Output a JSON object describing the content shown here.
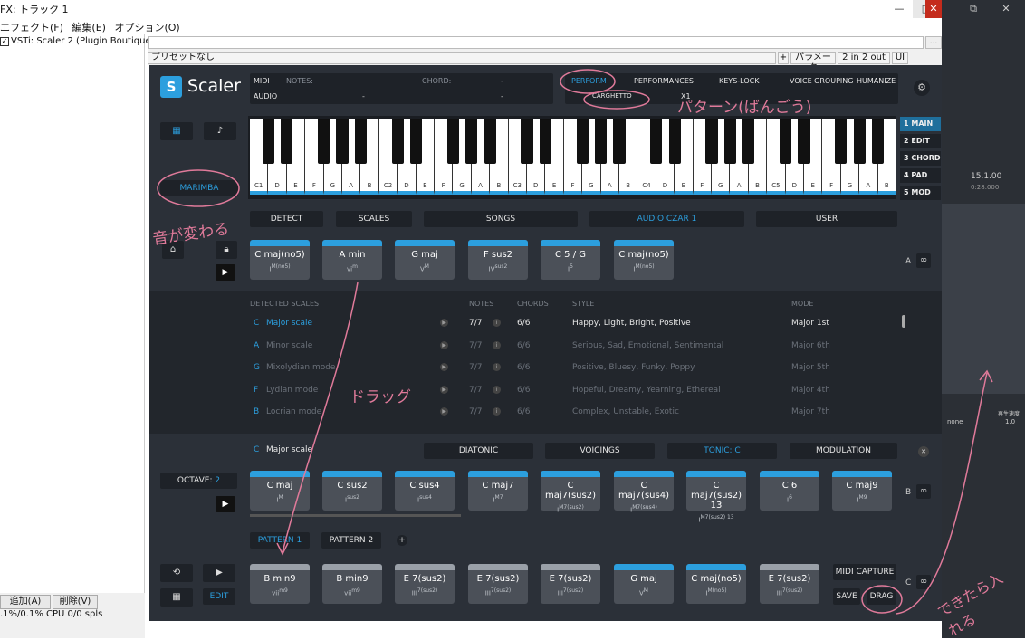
{
  "window": {
    "title": "FX: トラック 1",
    "minimize": "—",
    "restore": "□",
    "close": "✕",
    "right_restore": "⧉",
    "right_close": "✕"
  },
  "menu": [
    "エフェクト(F)",
    "編集(E)",
    "オプション(O)"
  ],
  "fx_list": {
    "item": "VSTi: Scaler 2 (Plugin Boutique)"
  },
  "bottom": {
    "add": "追加(A)",
    "remove": "削除(V)",
    "cpu": ".1%/0.1% CPU 0/0 spls"
  },
  "preset_bar": {
    "preset": "プリセットなし",
    "plus": "+",
    "params": "パラメータ",
    "io": "2 in 2 out",
    "ui": "UI",
    "more": "..."
  },
  "scaler": {
    "logo": "Scaler",
    "midi": "MIDI",
    "audio": "AUDIO",
    "notes_label": "NOTES:",
    "chord_label": "CHORD:",
    "dash": "-",
    "perform": "PERFORM",
    "performances": "PERFORMANCES",
    "carghetto": "CARGHETTO",
    "x1": "X1",
    "keys_lock": "KEYS-LOCK",
    "voice_grouping": "VOICE GROUPING",
    "humanize": "HUMANIZE",
    "sound": "MARIMBA",
    "side_tabs": [
      "1 MAIN",
      "2 EDIT",
      "3 CHORD",
      "4 PAD",
      "5 MOD"
    ],
    "octaves": [
      "C1",
      "C2",
      "C3",
      "C4",
      "C5"
    ],
    "white_keys": [
      "C1",
      "D",
      "E",
      "F",
      "G",
      "A",
      "B",
      "C2",
      "D",
      "E",
      "F",
      "G",
      "A",
      "B",
      "C3",
      "D",
      "E",
      "F",
      "G",
      "A",
      "B",
      "C4",
      "D",
      "E",
      "F",
      "G",
      "A",
      "B",
      "C5",
      "D",
      "E",
      "F",
      "G",
      "A",
      "B"
    ],
    "detect_bar": {
      "detect": "DETECT",
      "scales": "SCALES",
      "songs": "SONGS",
      "song": "AUDIO CZAR 1",
      "user": "USER"
    },
    "detected_chords": [
      {
        "name": "C maj(no5)",
        "roman": "I",
        "sup": "M(no5)"
      },
      {
        "name": "A min",
        "roman": "vi",
        "sup": "m"
      },
      {
        "name": "G maj",
        "roman": "V",
        "sup": "M"
      },
      {
        "name": "F sus2",
        "roman": "IV",
        "sup": "sus2"
      },
      {
        "name": "C 5 / G",
        "roman": "I",
        "sup": "5"
      },
      {
        "name": "C maj(no5)",
        "roman": "I",
        "sup": "M(no5)"
      }
    ],
    "section_a": "A",
    "scale_headers": {
      "scales": "DETECTED SCALES",
      "notes": "NOTES",
      "chords": "CHORDS",
      "style": "STYLE",
      "mode": "MODE"
    },
    "scales": [
      {
        "key": "C",
        "name": "Major scale",
        "notes": "7/7",
        "chords": "6/6",
        "style": "Happy, Light, Bright, Positive",
        "mode": "Major 1st"
      },
      {
        "key": "A",
        "name": "Minor scale",
        "notes": "7/7",
        "chords": "6/6",
        "style": "Serious, Sad, Emotional, Sentimental",
        "mode": "Major 6th"
      },
      {
        "key": "G",
        "name": "Mixolydian mode",
        "notes": "7/7",
        "chords": "6/6",
        "style": "Positive, Bluesy, Funky, Poppy",
        "mode": "Major 5th"
      },
      {
        "key": "F",
        "name": "Lydian mode",
        "notes": "7/7",
        "chords": "6/6",
        "style": "Hopeful, Dreamy, Yearning, Ethereal",
        "mode": "Major 4th"
      },
      {
        "key": "B",
        "name": "Locrian mode",
        "notes": "7/7",
        "chords": "6/6",
        "style": "Complex, Unstable, Exotic",
        "mode": "Major 7th"
      }
    ],
    "b_row": {
      "scale_key": "C",
      "scale_name": "Major scale",
      "diatonic": "DIATONIC",
      "voicings": "VOICINGS",
      "tonic": "TONIC: C",
      "modulation": "MODULATION"
    },
    "octave_label": "OCTAVE:",
    "octave_value": "2",
    "b_chords": [
      {
        "name": "C maj",
        "roman": "I",
        "sup": "M"
      },
      {
        "name": "C sus2",
        "roman": "I",
        "sup": "sus2"
      },
      {
        "name": "C sus4",
        "roman": "I",
        "sup": "sus4"
      },
      {
        "name": "C maj7",
        "roman": "I",
        "sup": "M7"
      },
      {
        "name": "C maj7(sus2)",
        "roman": "I",
        "sup": "M7(sus2)"
      },
      {
        "name": "C maj7(sus4)",
        "roman": "I",
        "sup": "M7(sus4)"
      },
      {
        "name": "C maj7(sus2) 13",
        "roman": "I",
        "sup": "M7(sus2) 13"
      },
      {
        "name": "C 6",
        "roman": "I",
        "sup": "6"
      },
      {
        "name": "C maj9",
        "roman": "I",
        "sup": "M9"
      }
    ],
    "section_b": "B",
    "pattern1": "PATTERN 1",
    "pattern2": "PATTERN 2",
    "c_chords": [
      {
        "name": "B min9",
        "roman": "vii",
        "sup": "m9"
      },
      {
        "name": "B min9",
        "roman": "vii",
        "sup": "m9"
      },
      {
        "name": "E 7(sus2)",
        "roman": "III",
        "sup": "7(sus2)"
      },
      {
        "name": "E 7(sus2)",
        "roman": "III",
        "sup": "7(sus2)"
      },
      {
        "name": "E 7(sus2)",
        "roman": "III",
        "sup": "7(sus2)"
      },
      {
        "name": "G maj",
        "roman": "V",
        "sup": "M"
      },
      {
        "name": "C maj(no5)",
        "roman": "I",
        "sup": "M(no5)"
      },
      {
        "name": "E 7(sus2)",
        "roman": "III",
        "sup": "7(sus2)"
      }
    ],
    "midi_capture": "MIDI CAPTURE",
    "save": "SAVE",
    "drag": "DRAG",
    "edit": "EDIT",
    "section_c": "C"
  },
  "daw_right": {
    "time": "15.1.00",
    "time_sub": "0:28.000",
    "none": "none",
    "value": "1.0",
    "label": "再生速度"
  },
  "annotations": {
    "pattern": "パターン(ばんごう)",
    "sound_change": "音が変わる",
    "drag": "ドラッグ",
    "done_insert": "できたら入れる"
  },
  "colors": {
    "accent": "#2c9fde",
    "panel": "#2b3038",
    "annotation": "#e07a9a"
  }
}
